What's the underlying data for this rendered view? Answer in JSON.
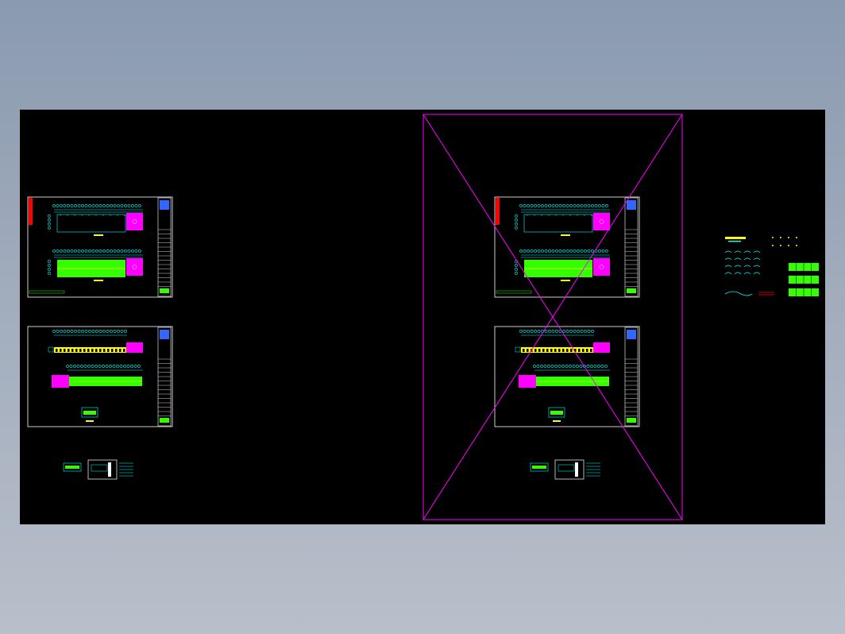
{
  "window": {
    "title": ""
  },
  "drawing": {
    "background": "#000000",
    "colors": {
      "frame": "#ffffff",
      "cyan": "#00ffff",
      "green": "#33ff00",
      "magenta": "#ff00ff",
      "yellow": "#ffff00",
      "red": "#ff0000",
      "blue": "#3366ff"
    },
    "sheet_groups": [
      {
        "name": "left-sheet-set",
        "sheets": [
          "top-sheet",
          "bottom-sheet"
        ],
        "detail_row": true
      },
      {
        "name": "middle-sheet-set",
        "sheets": [
          "top-sheet",
          "bottom-sheet"
        ],
        "detail_row": true,
        "print_area_box": true
      }
    ],
    "right_legend": {
      "present": true
    }
  }
}
